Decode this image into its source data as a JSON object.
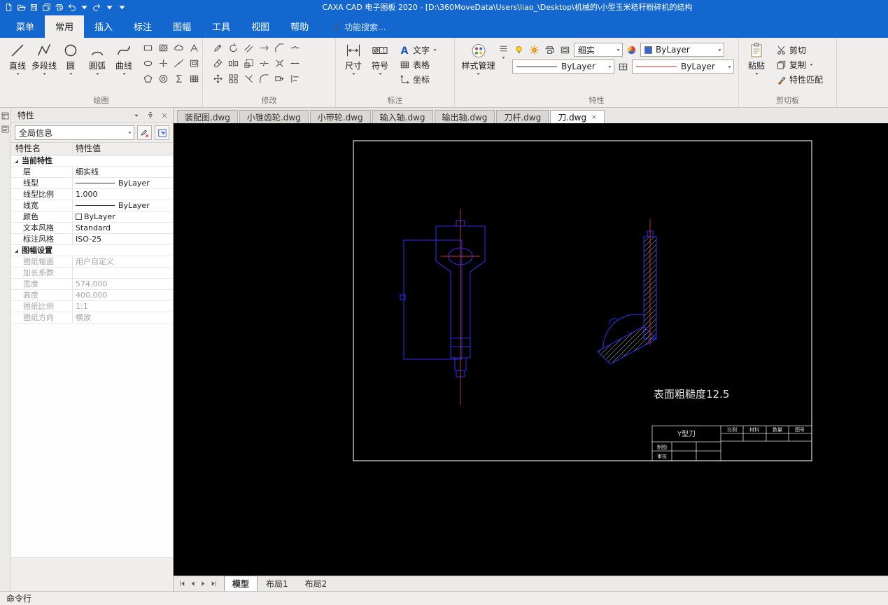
{
  "titlebar": {
    "icons": [
      "new-file-icon",
      "open-file-icon",
      "save-icon",
      "save-all-icon",
      "print-icon",
      "undo-icon",
      "caret-down-icon",
      "redo-icon",
      "caret-down-icon",
      "caret-down-icon"
    ],
    "title": "CAXA CAD 电子图板 2020 - [D:\\360MoveData\\Users\\liao_\\Desktop\\机械的\\小型玉米秸秆粉碎机的结构"
  },
  "menubar": {
    "items": [
      {
        "label": "菜单",
        "active": false
      },
      {
        "label": "常用",
        "active": true
      },
      {
        "label": "插入",
        "active": false
      },
      {
        "label": "标注",
        "active": false
      },
      {
        "label": "图幅",
        "active": false
      },
      {
        "label": "工具",
        "active": false
      },
      {
        "label": "视图",
        "active": false
      },
      {
        "label": "帮助",
        "active": false
      }
    ],
    "search": "功能搜索..."
  },
  "ribbon": {
    "draw": {
      "label": "绘图",
      "big_tools": [
        {
          "label": "直线",
          "icon": "line-icon"
        },
        {
          "label": "多段线",
          "icon": "polyline-icon"
        },
        {
          "label": "圆",
          "icon": "circle-icon"
        },
        {
          "label": "圆弧",
          "icon": "arc-icon"
        },
        {
          "label": "曲线",
          "icon": "spline-icon"
        }
      ],
      "small_tools": [
        "rectangle-icon",
        "ellipse-icon",
        "polygon-icon",
        "hatch-icon",
        "point-icon",
        "donut-icon",
        "cloud-icon",
        "xline-icon",
        "formula-icon",
        "mtext-icon",
        "frame-icon",
        "table-icon"
      ]
    },
    "modify": {
      "label": "修改",
      "tools": [
        "edit-icon",
        "erase-icon",
        "move-icon",
        "rotate-icon",
        "mirror-icon",
        "array-icon",
        "offset-icon",
        "scale-icon",
        "trim-icon",
        "extend-icon",
        "break-icon",
        "fillet-icon",
        "chamfer-icon",
        "explode-icon",
        "stretch-icon",
        "join-icon",
        "divide-icon",
        "align-icon"
      ]
    },
    "annotate": {
      "label": "标注",
      "dimension": "尺寸",
      "symbol": "符号",
      "text": "文字",
      "table": "表格",
      "coordinate": "坐标"
    },
    "properties": {
      "label": "特性",
      "style_manager": "样式管理",
      "layer": "细实",
      "color": "ByLayer",
      "linetype": "ByLayer",
      "lineweight": "ByLayer"
    },
    "clipboard": {
      "label": "剪切板",
      "paste": "粘贴",
      "cut": "剪切",
      "copy": "复制",
      "match": "特性匹配"
    }
  },
  "properties_panel": {
    "title": "特性",
    "selector": "全局信息",
    "columns": [
      "特性名",
      "特性值"
    ],
    "sections": [
      {
        "title": "当前特性",
        "disabled": false,
        "rows": [
          {
            "name": "层",
            "value": "细实线",
            "kind": "text"
          },
          {
            "name": "线型",
            "value": "ByLayer",
            "kind": "line"
          },
          {
            "name": "线型比例",
            "value": "1.000",
            "kind": "text"
          },
          {
            "name": "线宽",
            "value": "ByLayer",
            "kind": "line"
          },
          {
            "name": "颜色",
            "value": "ByLayer",
            "kind": "swatch"
          },
          {
            "name": "文本风格",
            "value": "Standard",
            "kind": "text"
          },
          {
            "name": "标注风格",
            "value": "ISO-25",
            "kind": "text"
          }
        ]
      },
      {
        "title": "图幅设置",
        "disabled": true,
        "rows": [
          {
            "name": "图纸幅面",
            "value": "用户自定义",
            "kind": "text"
          },
          {
            "name": "加长系数",
            "value": "",
            "kind": "text"
          },
          {
            "name": "宽度",
            "value": "574.000",
            "kind": "text"
          },
          {
            "name": "高度",
            "value": "400.000",
            "kind": "text"
          },
          {
            "name": "图纸比例",
            "value": "1:1",
            "kind": "text"
          },
          {
            "name": "图纸方向",
            "value": "横放",
            "kind": "text"
          }
        ]
      }
    ]
  },
  "doc_tabs": [
    {
      "label": "装配图.dwg",
      "active": false
    },
    {
      "label": "小锥齿轮.dwg",
      "active": false
    },
    {
      "label": "小带轮.dwg",
      "active": false
    },
    {
      "label": "输入轴.dwg",
      "active": false
    },
    {
      "label": "输出轴.dwg",
      "active": false
    },
    {
      "label": "刀杆.dwg",
      "active": false
    },
    {
      "label": "刀.dwg",
      "active": true
    }
  ],
  "canvas": {
    "surface_note": "表面粗糙度12.5",
    "title_block": {
      "name": "Y型刀",
      "headers": [
        "比例",
        "材料",
        "数量",
        "图号"
      ],
      "left_labels": [
        "制图",
        "审核"
      ]
    }
  },
  "layout_nav": [
    "first-page-icon",
    "prev-page-icon",
    "next-page-icon",
    "last-page-icon"
  ],
  "layout_tabs": [
    {
      "label": "模型",
      "active": true
    },
    {
      "label": "布局1",
      "active": false
    },
    {
      "label": "布局2",
      "active": false
    }
  ],
  "command_line": {
    "label": "命令行"
  }
}
